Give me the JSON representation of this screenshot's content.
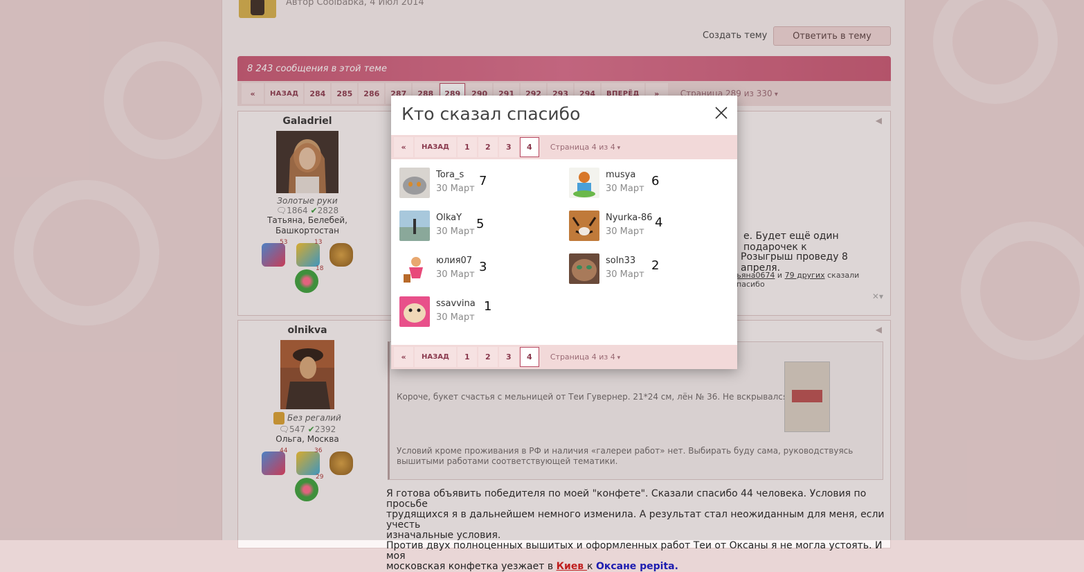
{
  "thread": {
    "author_line": "Автор Coolbabka, 4 Июл 2014",
    "create_topic": "Создать тему",
    "reply_button": "Ответить в тему",
    "messages_count": "8 243 сообщения в этой теме"
  },
  "pager": {
    "first": "«",
    "prev": "НАЗАД",
    "pages": [
      "284",
      "285",
      "286",
      "287",
      "288",
      "289",
      "290",
      "291",
      "292",
      "293",
      "294"
    ],
    "current": "289",
    "next": "ВПЕРЁД",
    "last": "»",
    "page_of": "Страница 289 из 330"
  },
  "posts": [
    {
      "username": "Galadriel",
      "user_title": "Золотые руки",
      "stats": {
        "comments": "1864",
        "likes": "2828"
      },
      "location": "Татьяна, Белебей, Башкортостан",
      "awards": {
        "a1": "53",
        "a2": "13",
        "a3": "18"
      },
      "body_right_1": "е. Будет ещё один подарочек к",
      "body_right_2": "Розыгрыш проведу 8 апреля.",
      "thanks_line": {
        "who": "тьяна0674",
        "and": " и ",
        "others": "79 других",
        "tail": " сказали спасибо"
      }
    },
    {
      "username": "olnikva",
      "user_title": "Без регалий",
      "stats": {
        "comments": "547",
        "likes": "2392"
      },
      "location": "Ольга, Москва",
      "awards": {
        "a1": "44",
        "a2": "36",
        "a3": "29"
      },
      "quote_1": "Короче, букет счастья с мельницей от Теи Гувернер. 21*24 см, лён № 36. Не вскрывался.",
      "quote_2": "Условий кроме проживания в РФ и наличия «галереи работ» нет. Выбирать буду сама, руководствуясь",
      "quote_3": "вышитыми работами соответствующей тематики.",
      "text_1": "Я готова объявить победителя по моей \"конфете\".  Сказали спасибо 44 человека. Условия по просьбе",
      "text_2": "трудящихся я в дальнейшем немного изменила. А результат стал неожиданным для меня, если учесть",
      "text_3": "изначальные условия.",
      "text_4": "Против двух полноценных вышитых и оформленных работ Теи от Оксаны я не могла устоять. И моя",
      "text_5": "московская конфетка уезжает в ",
      "link_city": "Киев ",
      "text_6": "к ",
      "link_person": "Оксане pepita."
    }
  ],
  "modal": {
    "title": "Кто сказал спасибо",
    "pager": {
      "first": "«",
      "prev": "НАЗАД",
      "pages": [
        "1",
        "2",
        "3",
        "4"
      ],
      "current": "4",
      "page_of": "Страница 4 из 4"
    },
    "likers": [
      {
        "name": "Tora_s",
        "date": "30 Март",
        "num": "7"
      },
      {
        "name": "musya",
        "date": "30 Март",
        "num": "6"
      },
      {
        "name": "OlkaY",
        "date": "30 Март",
        "num": "5"
      },
      {
        "name": "Nyurka-86",
        "date": "30 Март",
        "num": "4"
      },
      {
        "name": "юлия07",
        "date": "30 Март",
        "num": "3"
      },
      {
        "name": "soln33",
        "date": "30 Март",
        "num": "2"
      },
      {
        "name": "ssavvina",
        "date": "30 Март",
        "num": "1"
      }
    ]
  },
  "colors": {
    "accent": "#b84a62",
    "header_bar": "#c75672",
    "pager_bg": "#f2d9d9"
  }
}
